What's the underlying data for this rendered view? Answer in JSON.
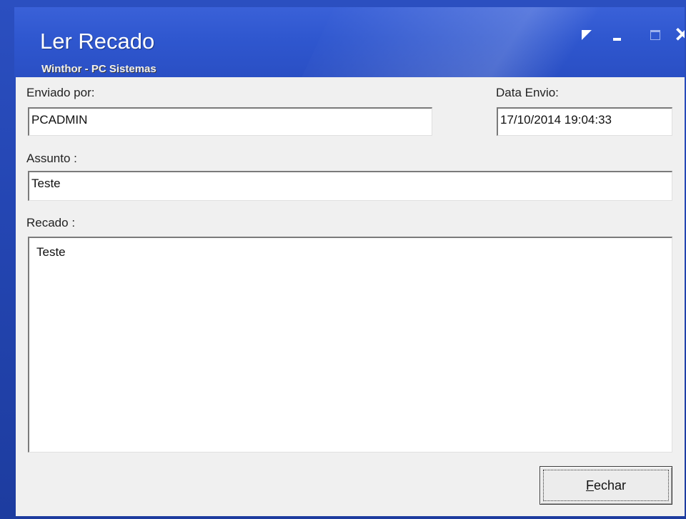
{
  "window": {
    "title": "Ler Recado",
    "subtitle": "Winthor - PC Sistemas",
    "buttons": {
      "restore": "restore-icon",
      "minimize": "minimize-icon",
      "maximize": "maximize-icon",
      "close": "close-icon"
    }
  },
  "form": {
    "sender_label": "Enviado por:",
    "sender_value": "PCADMIN",
    "date_label": "Data Envio:",
    "date_value": "17/10/2014 19:04:33",
    "subject_label": "Assunto :",
    "subject_value": "Teste",
    "message_label": "Recado :",
    "message_value": "Teste"
  },
  "actions": {
    "close_label": "Fechar"
  },
  "colors": {
    "titlebar": "#2f57cf",
    "client_bg": "#f0f0f0",
    "field_bg": "#ffffff"
  }
}
